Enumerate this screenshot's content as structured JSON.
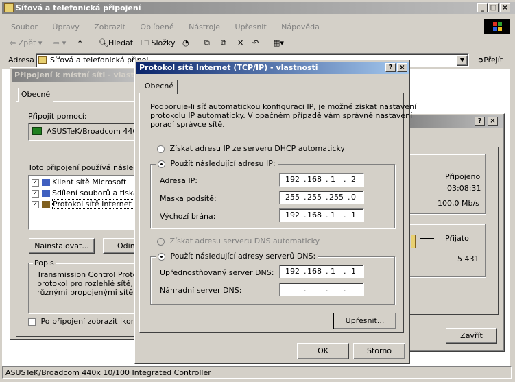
{
  "main_window": {
    "title": "Síťová a telefonická připojení",
    "menu": [
      "Soubor",
      "Úpravy",
      "Zobrazit",
      "Oblíbené",
      "Nástroje",
      "Upřesnit",
      "Nápověda"
    ],
    "toolbar": {
      "back": "Zpět",
      "search": "Hledat",
      "folders": "Složky"
    },
    "address_label": "Adresa",
    "address_value": "Síťová a telefonická připoj...",
    "go_label": "Přejít",
    "statusbar": "ASUSTeK/Broadcom 440x 10/100 Integrated Controller"
  },
  "local_conn_dialog": {
    "title": "Připojení k místní síti - vlastnost",
    "tab": "Obecné",
    "connect_using_label": "Připojit pomocí:",
    "adapter": "ASUSTeK/Broadcom 440",
    "uses_label": "Toto připojení používá následují",
    "items": [
      {
        "label": "Klient sítě Microsoft",
        "checked": true
      },
      {
        "label": "Sdílení souborů a tiskár",
        "checked": true
      },
      {
        "label": "Protokol sítě Internet (TC",
        "checked": true
      }
    ],
    "install_button": "Nainstalovat...",
    "uninstall_button": "Odin",
    "description_title": "Popis",
    "description": "Transmission Control Protocol/Internet Protocol. Výchozí protokol pro rozlehlé sítě, který umožňuje komunikaci mezi různými propojenými sítěmi.",
    "description_lines": [
      "Transmission Control Protocol",
      "protokol pro rozlehlé sítě, kter",
      "různými propojenými sítěmi."
    ],
    "show_icon_label": "Po připojení zobrazit ikonu n"
  },
  "status_dialog": {
    "status_value": "Připojeno",
    "duration_value": "03:08:31",
    "speed_value": "100,0 Mb/s",
    "received_label": "Přijato",
    "received_value": "5 431",
    "close_button": "Zavřít"
  },
  "tcpip_dialog": {
    "title": "Protokol sítě Internet (TCP/IP) - vlastnosti",
    "tab": "Obecné",
    "intro": [
      "Podporuje-li síť automatickou konfiguraci IP, je možné získat nastavení",
      "protokolu IP automaticky. V opačném případě vám správné nastavení",
      "poradí správce sítě."
    ],
    "radio_dhcp": "Získat adresu IP ze serveru DHCP automaticky",
    "radio_static": "Použít následující adresu IP:",
    "ip_label": "Adresa IP:",
    "ip_value": [
      "192",
      "168",
      "1",
      "2"
    ],
    "mask_label": "Maska podsítě:",
    "mask_value": [
      "255",
      "255",
      "255",
      "0"
    ],
    "gateway_label": "Výchozí brána:",
    "gateway_value": [
      "192",
      "168",
      "1",
      "1"
    ],
    "radio_dns_auto": "Získat adresu serveru DNS automaticky",
    "radio_dns_static": "Použít následující adresy serverů DNS:",
    "dns1_label": "Upřednostňovaný server DNS:",
    "dns1_value": [
      "192",
      "168",
      "1",
      "1"
    ],
    "dns2_label": "Náhradní server DNS:",
    "dns2_value": [
      "",
      "",
      "",
      ""
    ],
    "advanced_button": "Upřesnit...",
    "ok_button": "OK",
    "cancel_button": "Storno"
  },
  "colors": {
    "active_title": "#0a246a",
    "face": "#d4d0c8"
  }
}
